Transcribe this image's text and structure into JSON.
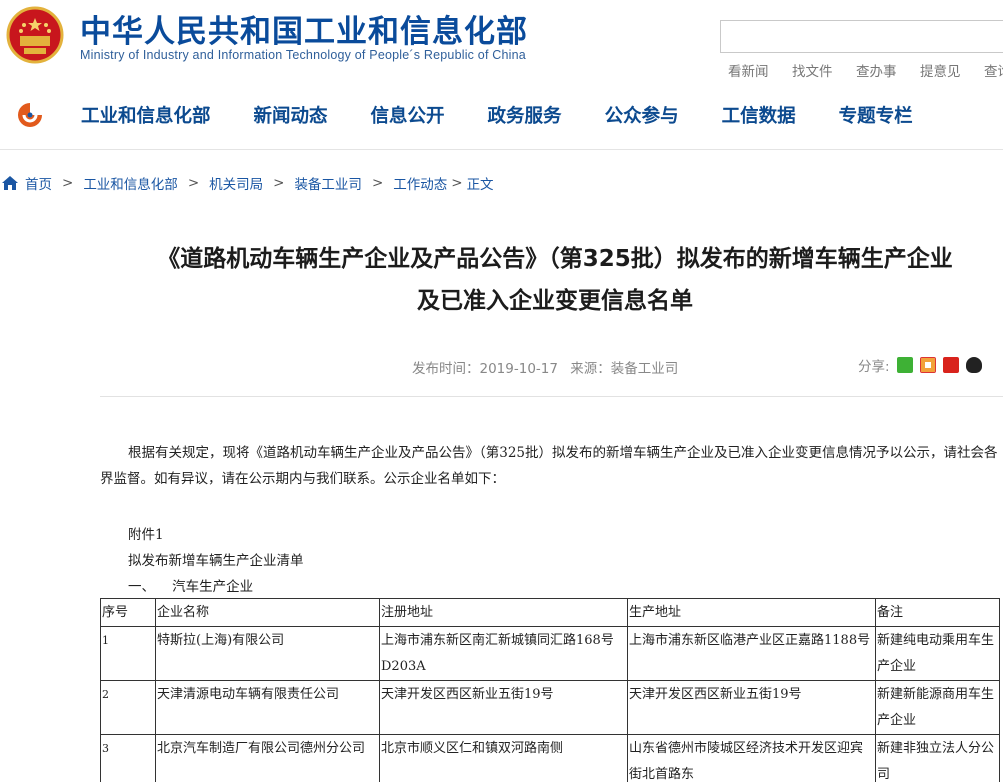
{
  "header": {
    "title": "中华人民共和国工业和信息化部",
    "subtitle": "Ministry of Industry and Information Technology of People´s Republic of China",
    "search_placeholder": "",
    "quick_links": [
      "看新闻",
      "找文件",
      "查办事",
      "提意见",
      "查询"
    ]
  },
  "nav": {
    "items": [
      "工业和信息化部",
      "新闻动态",
      "信息公开",
      "政务服务",
      "公众参与",
      "工信数据",
      "专题专栏"
    ]
  },
  "breadcrumb": {
    "items": [
      "首页",
      "工业和信息化部",
      "机关司局",
      "装备工业司",
      "工作动态"
    ],
    "current": "正文"
  },
  "article": {
    "title_line1": "《道路机动车辆生产企业及产品公告》（第325批）拟发布的新增车辆生产企业",
    "title_line2": "及已准入企业变更信息名单",
    "publish_time": "发布时间：2019-10-17",
    "source": "来源：装备工业司",
    "share_label": "分享:",
    "intro": "根据有关规定，现将《道路机动车辆生产企业及产品公告》（第325批）拟发布的新增车辆生产企业及已准入企业变更信息情况予以公示，请社会各界监督。如有异议，请在公示期内与我们联系。公示企业名单如下：",
    "attachment": "附件1",
    "list_title": "拟发布新增车辆生产企业清单",
    "section": "一、    汽车生产企业"
  },
  "table": {
    "headers": [
      "序号",
      "企业名称",
      "注册地址",
      "生产地址",
      "备注"
    ],
    "rows": [
      [
        "1",
        "特斯拉(上海)有限公司",
        "上海市浦东新区南汇新城镇同汇路168号D203A",
        "上海市浦东新区临港产业区正嘉路1188号",
        "新建纯电动乘用车生产企业"
      ],
      [
        "2",
        "天津清源电动车辆有限责任公司",
        "天津开发区西区新业五街19号",
        "天津开发区西区新业五街19号",
        "新建新能源商用车生产企业"
      ],
      [
        "3",
        "北京汽车制造厂有限公司德州分公司",
        "北京市顺义区仁和镇双河路南侧",
        "山东省德州市陵城区经济技术开发区迎宾街北首路东",
        "新建非独立法人分公司"
      ]
    ]
  },
  "colors": {
    "brand_blue": "#0a4b9b",
    "link_blue": "#1a56a3"
  }
}
